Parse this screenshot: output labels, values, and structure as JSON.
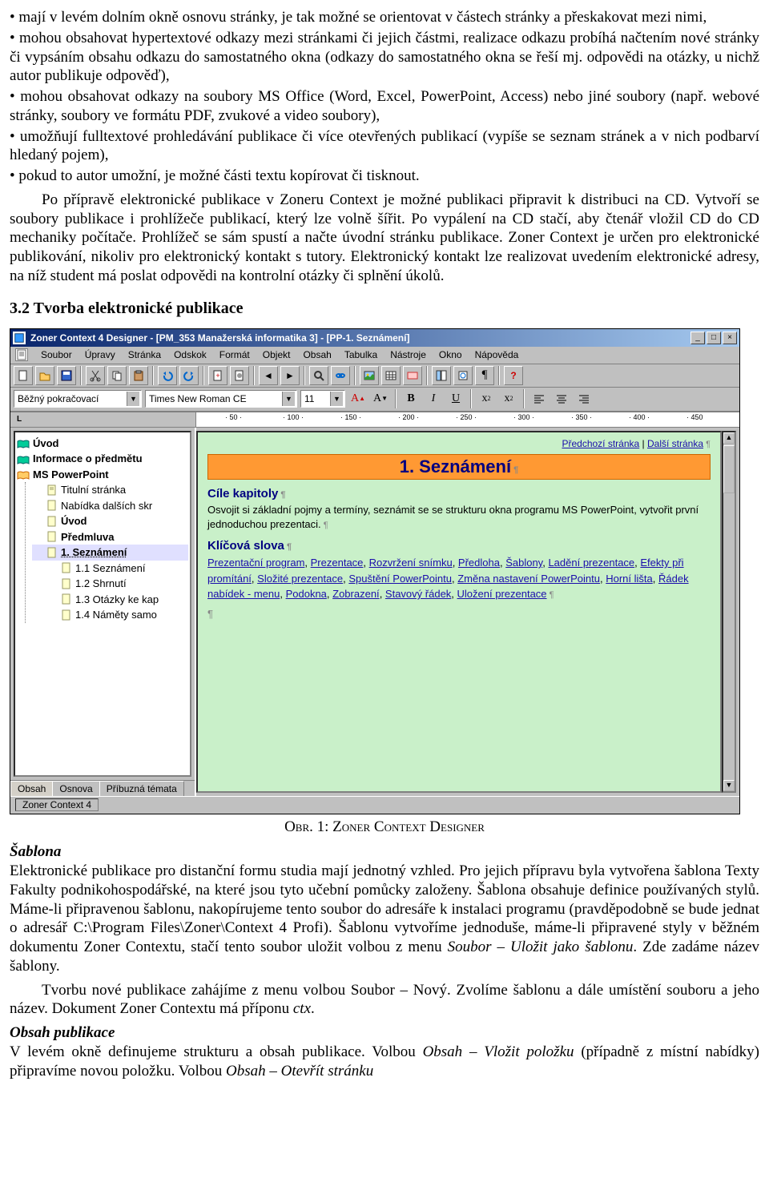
{
  "bullets_top": [
    "mají v levém dolním okně osnovu stránky, je tak možné se orientovat v částech stránky a přeskakovat mezi nimi,",
    "mohou obsahovat hypertextové odkazy mezi stránkami či jejich částmi, realizace odkazu probíhá načtením nové stránky či vypsáním obsahu odkazu do samostatného okna (odkazy do samostatného okna se řeší mj. odpovědi na otázky, u nichž autor publikuje odpověď),",
    "mohou obsahovat odkazy na soubory MS Office (Word, Excel, PowerPoint, Access) nebo jiné soubory (např. webové stránky, soubory ve formátu PDF, zvukové a video soubory),",
    "umožňují fulltextové prohledávání publikace či více otevřených publikací (vypíše se seznam stránek a v nich podbarví hledaný pojem),",
    "pokud to autor umožní, je možné části textu kopírovat či tisknout."
  ],
  "para_after_bullets": "Po přípravě elektronické publikace v Zoneru Context je možné publikaci připravit k distribuci na CD. Vytvoří se soubory publikace i prohlížeče publikací, který lze volně šířit. Po vypálení na CD stačí, aby čtenář vložil CD do CD mechaniky počítače. Prohlížeč se sám spustí a načte úvodní stránku publikace. Zoner Context je určen pro elektronické publikování, nikoliv pro elektronický kontakt s tutory. Elektronický kontakt lze realizovat uvedením elektronické adresy, na níž student má poslat odpovědi na kontrolní otázky či splnění úkolů.",
  "section_heading": "3.2 Tvorba elektronické publikace",
  "app": {
    "title": "Zoner Context 4 Designer - [PM_353 Manažerská informatika 3] - [PP-1. Seznámení]",
    "menus": [
      "Soubor",
      "Úpravy",
      "Stránka",
      "Odskok",
      "Formát",
      "Objekt",
      "Obsah",
      "Tabulka",
      "Nástroje",
      "Okno",
      "Nápověda"
    ],
    "style_combo": "Běžný pokračovací",
    "font_combo": "Times New Roman CE",
    "size_combo": "11",
    "ruler_label": "L",
    "ruler_ticks": [
      "· 50 ·",
      "· 100 ·",
      "· 150 ·",
      "· 200 ·",
      "· 250 ·",
      "· 300 ·",
      "· 350 ·",
      "· 400 ·",
      "· 450"
    ],
    "tree": {
      "top": [
        {
          "label": "Úvod",
          "icon": "book"
        },
        {
          "label": "Informace o předmětu",
          "icon": "book"
        },
        {
          "label": "MS PowerPoint",
          "icon": "book",
          "bold": true
        }
      ],
      "children": [
        {
          "label": "Titulní stránka",
          "icon": "page"
        },
        {
          "label": "Nabídka dalších skr",
          "icon": "page"
        },
        {
          "label": "Úvod",
          "icon": "page",
          "bold": true
        },
        {
          "label": "Předmluva",
          "icon": "page",
          "bold": true
        },
        {
          "label": "1. Seznámení",
          "icon": "page",
          "bold": true,
          "selected": true
        },
        {
          "label": "1.1 Seznámení",
          "icon": "page"
        },
        {
          "label": "1.2 Shrnutí",
          "icon": "page"
        },
        {
          "label": "1.3 Otázky ke kap",
          "icon": "page"
        },
        {
          "label": "1.4 Náměty samo",
          "icon": "page"
        }
      ]
    },
    "tabs": [
      "Obsah",
      "Osnova",
      "Příbuzná témata"
    ],
    "content": {
      "nav_prev": "Předchozí stránka",
      "nav_next": "Další stránka",
      "h1": "1. Seznámení",
      "hsec1": "Cíle kapitoly",
      "body1": "Osvojit si základní pojmy a termíny, seznámit se se strukturu okna programu MS PowerPoint, vytvořit  první jednoduchou prezentaci.",
      "hsec2": "Klíčová slova",
      "keywords": [
        "Prezentační program",
        "Prezentace",
        "Rozvržení snímku",
        "Předloha",
        "Šablony",
        "Ladění prezentace",
        "Efekty při promítání",
        "Složité prezentace",
        "Spuštění PowerPointu",
        "Změna nastavení PowerPointu",
        "Horní lišta",
        "Řádek nabídek - menu",
        "Podokna",
        "Zobrazení",
        "Stavový řádek",
        "Uložení prezentace"
      ]
    },
    "status": "Zoner Context 4"
  },
  "figure_caption": "Obr. 1: Zoner Context Designer",
  "post": {
    "sablona_label": "Šablona",
    "sablona_para1": "Elektronické publikace pro distanční formu studia mají jednotný vzhled. Pro jejich přípravu byla vytvořena šablona Texty Fakulty podnikohospodářské, na které jsou tyto učební pomůcky založeny. Šablona obsahuje definice používaných stylů. Máme-li připravenou šablonu, nakopírujeme tento soubor do adresáře k instalaci programu (pravděpodobně se bude jednat o adresář C:\\Program Files\\Zoner\\Context 4 Profi). Šablonu vytvoříme jednoduše, máme-li připravené styly v běžném dokumentu Zoner Contextu, stačí tento soubor uložit volbou z menu ",
    "sablona_menu": "Soubor – Uložit jako šablonu",
    "sablona_para1_tail": ". Zde zadáme název šablony.",
    "sablona_para2": "Tvorbu nové publikace zahájíme z menu volbou Soubor – Nový. Zvolíme šablonu a dále umístění souboru a jeho název. Dokument Zoner Contextu má příponu ",
    "sablona_ctx": "ctx",
    "obsah_label": "Obsah publikace",
    "obsah_para_a": "V levém okně definujeme strukturu a obsah publikace. Volbou ",
    "obsah_menu1": "Obsah – Vložit položku",
    "obsah_para_b": " (případně z místní nabídky) připravíme novou položku. Volbou ",
    "obsah_menu2": "Obsah – Otevřít stránku"
  }
}
